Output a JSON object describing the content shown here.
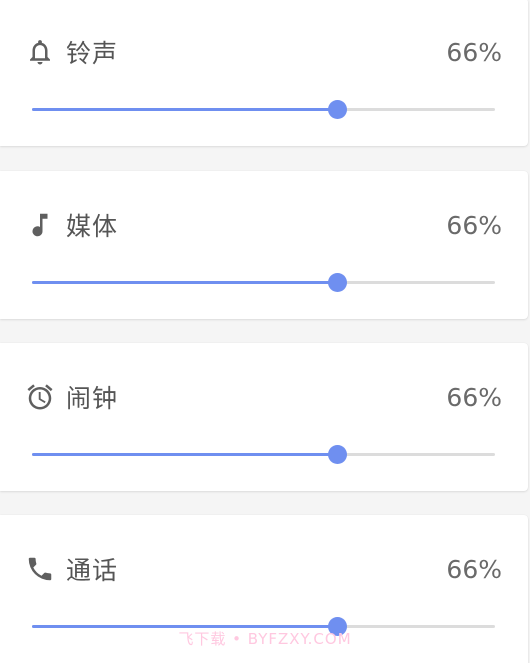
{
  "volumes": [
    {
      "label": "铃声",
      "value_text": "66%",
      "level": 0.66,
      "icon": "bell-icon"
    },
    {
      "label": "媒体",
      "value_text": "66%",
      "level": 0.66,
      "icon": "music-note-icon"
    },
    {
      "label": "闹钟",
      "value_text": "66%",
      "level": 0.66,
      "icon": "alarm-clock-icon"
    },
    {
      "label": "通话",
      "value_text": "66%",
      "level": 0.66,
      "icon": "phone-icon"
    }
  ],
  "colors": {
    "accent": "#6f8ff0",
    "track": "#dcdcdc",
    "icon": "#5f5f5f",
    "text": "#555555"
  },
  "watermark": "飞下载 • BYFZXY.COM"
}
